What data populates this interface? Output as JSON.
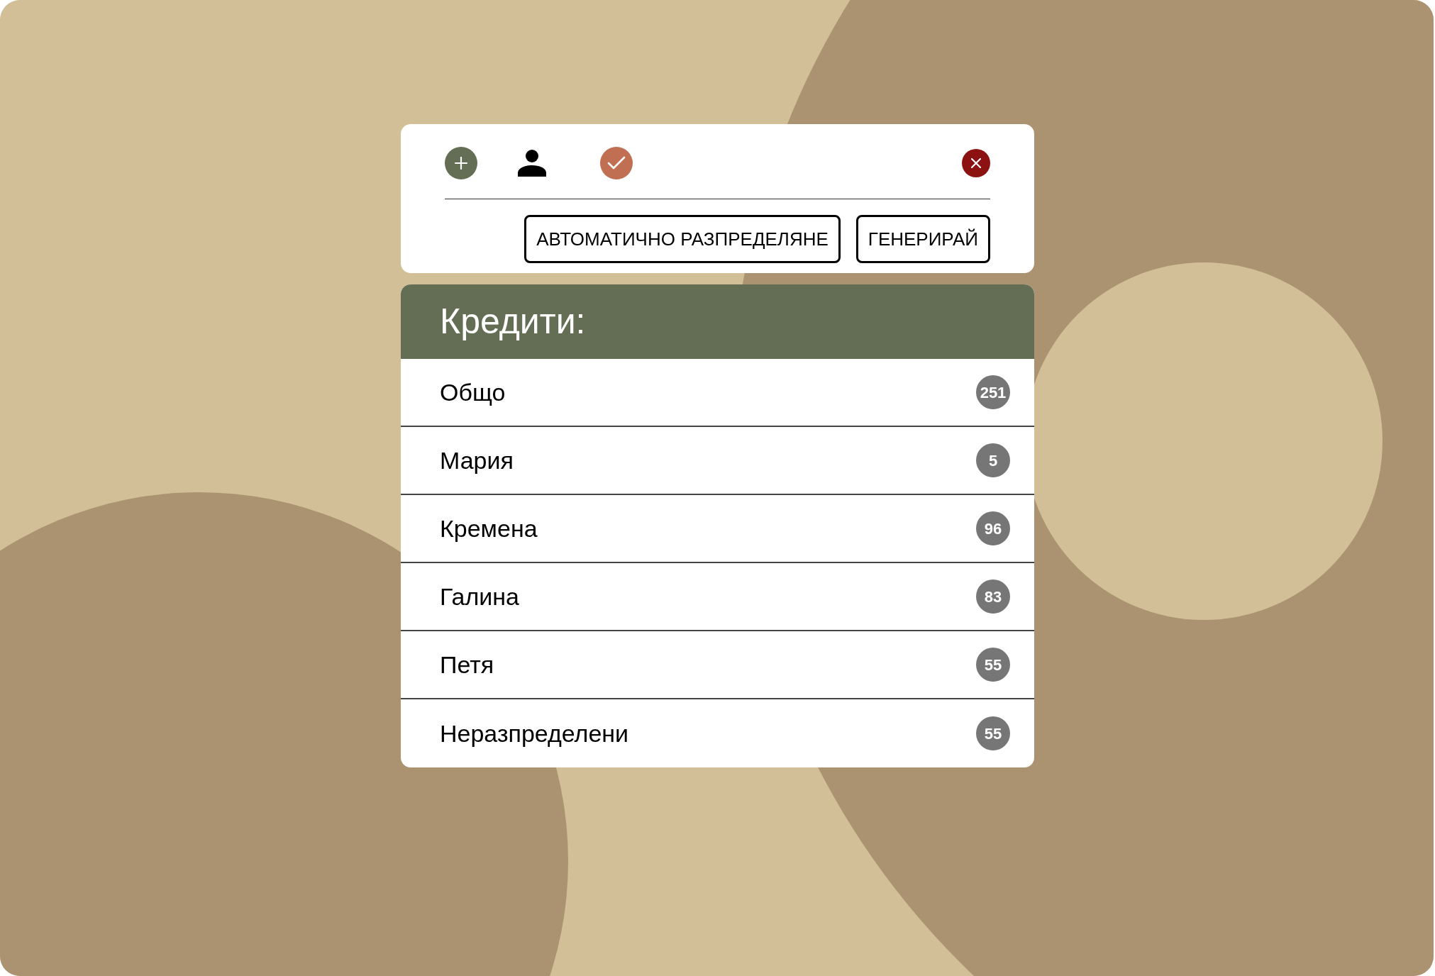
{
  "toolbar": {
    "buttons": [
      "АВТОМАТИЧНО РАЗПРЕДЕЛЯНЕ",
      "ГЕНЕРИРАЙ"
    ]
  },
  "credits": {
    "title": "Кредити:",
    "rows": [
      {
        "name": "Общо",
        "count": "251"
      },
      {
        "name": "Мария",
        "count": "5"
      },
      {
        "name": "Кремена",
        "count": "96"
      },
      {
        "name": "Галина",
        "count": "83"
      },
      {
        "name": "Петя",
        "count": "55"
      },
      {
        "name": "Неразпределени",
        "count": "55"
      }
    ]
  }
}
